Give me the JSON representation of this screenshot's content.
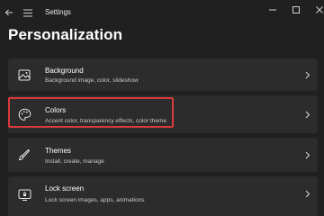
{
  "window": {
    "app_title": "Settings",
    "back_icon": "back-arrow-icon",
    "menu_icon": "hamburger-menu-icon",
    "controls": [
      "minimize-icon",
      "maximize-icon",
      "close-icon"
    ]
  },
  "page": {
    "title": "Personalization"
  },
  "settings": [
    {
      "title": "Background",
      "description": "Background image, color, slideshow",
      "icon": "image-icon"
    },
    {
      "title": "Colors",
      "description": "Accent color, transparency effects, color theme",
      "icon": "palette-icon"
    },
    {
      "title": "Themes",
      "description": "Install, create, manage",
      "icon": "brush-icon"
    },
    {
      "title": "Lock screen",
      "description": "Lock screen images, apps, animations",
      "icon": "lock-screen-icon"
    }
  ],
  "colors": {
    "background": "#202020",
    "card": "#2c2c2c",
    "highlight_border": "#d9393b"
  }
}
